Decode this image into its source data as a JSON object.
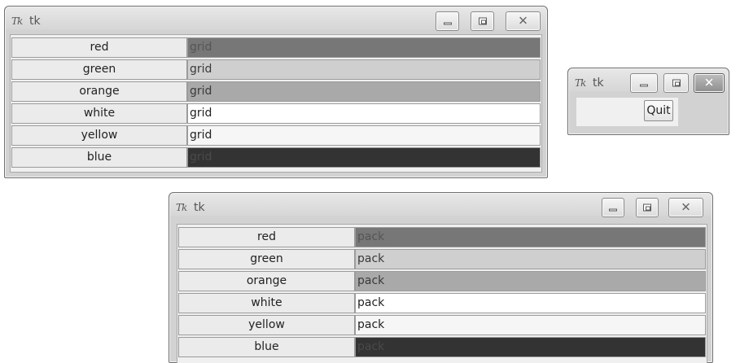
{
  "windows": {
    "grid": {
      "icon": "Tk",
      "title": "tk",
      "rows": [
        {
          "label": "red",
          "value": "grid",
          "bg": "#777777",
          "fg": "#555555"
        },
        {
          "label": "green",
          "value": "grid",
          "bg": "#cfcfcf",
          "fg": "#3a3a3a"
        },
        {
          "label": "orange",
          "value": "grid",
          "bg": "#a9a9a9",
          "fg": "#3a3a3a"
        },
        {
          "label": "white",
          "value": "grid",
          "bg": "#ffffff",
          "fg": "#222222"
        },
        {
          "label": "yellow",
          "value": "grid",
          "bg": "#f6f6f6",
          "fg": "#222222"
        },
        {
          "label": "blue",
          "value": "grid",
          "bg": "#333333",
          "fg": "#4a4a4a"
        }
      ]
    },
    "quit": {
      "icon": "Tk",
      "title": "tk",
      "button_label": "Quit"
    },
    "pack": {
      "icon": "Tk",
      "title": "tk",
      "rows": [
        {
          "label": "red",
          "value": "pack",
          "bg": "#777777",
          "fg": "#555555"
        },
        {
          "label": "green",
          "value": "pack",
          "bg": "#cfcfcf",
          "fg": "#3a3a3a"
        },
        {
          "label": "orange",
          "value": "pack",
          "bg": "#a9a9a9",
          "fg": "#3a3a3a"
        },
        {
          "label": "white",
          "value": "pack",
          "bg": "#ffffff",
          "fg": "#222222"
        },
        {
          "label": "yellow",
          "value": "pack",
          "bg": "#f6f6f6",
          "fg": "#222222"
        },
        {
          "label": "blue",
          "value": "pack",
          "bg": "#333333",
          "fg": "#4a4a4a"
        }
      ]
    }
  },
  "icons": {
    "minimize": "minimize-icon",
    "maximize": "maximize-icon",
    "close": "close-icon",
    "close_glyph": "✕"
  }
}
